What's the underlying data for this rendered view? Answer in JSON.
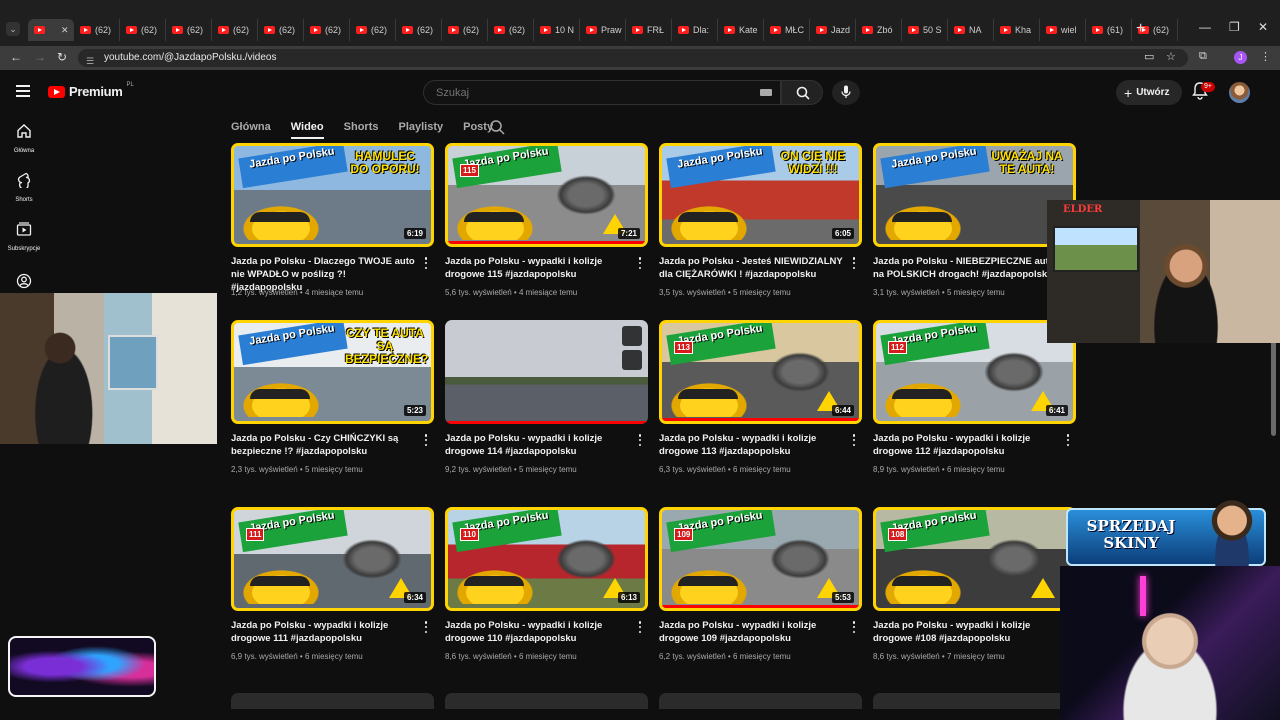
{
  "browser": {
    "tabs": [
      {
        "label": "",
        "active": true
      },
      {
        "label": "(62)"
      },
      {
        "label": "(62)"
      },
      {
        "label": "(62)"
      },
      {
        "label": "(62)"
      },
      {
        "label": "(62)"
      },
      {
        "label": "(62)"
      },
      {
        "label": "(62)"
      },
      {
        "label": "(62)"
      },
      {
        "label": "(62)"
      },
      {
        "label": "(62)"
      },
      {
        "label": "10 N"
      },
      {
        "label": "Praw"
      },
      {
        "label": "FRŁ"
      },
      {
        "label": "Dla:"
      },
      {
        "label": "Kate"
      },
      {
        "label": "MŁC"
      },
      {
        "label": "Jazd"
      },
      {
        "label": "Zbó"
      },
      {
        "label": "50 S"
      },
      {
        "label": "NA"
      },
      {
        "label": "Kha"
      },
      {
        "label": "wiel"
      },
      {
        "label": "(61)"
      },
      {
        "label": "(62)"
      }
    ],
    "url": "youtube.com/@JazdapoPolsku./videos",
    "profile_initial": "J"
  },
  "header": {
    "logo_text": "Premium",
    "logo_country": "PL",
    "search_placeholder": "Szukaj",
    "create_label": "Utwórz",
    "notification_badge": "9+"
  },
  "guide": {
    "items": [
      {
        "label": "Główna",
        "icon": "home-icon"
      },
      {
        "label": "Shorts",
        "icon": "shorts-icon"
      },
      {
        "label": "Subskrypcje",
        "icon": "subscriptions-icon"
      },
      {
        "label": "",
        "icon": "you-icon"
      }
    ]
  },
  "channel_tabs": [
    {
      "label": "Główna"
    },
    {
      "label": "Wideo",
      "active": true
    },
    {
      "label": "Shorts"
    },
    {
      "label": "Playlisty"
    },
    {
      "label": "Posty"
    }
  ],
  "videos": [
    {
      "title": "Jazda po Polsku - Dlaczego TWOJE auto nie WPADŁO w poślizg ?! #jazdapopolsku",
      "views": "1,2 tys. wyświetleń",
      "age": "4 miesiące temu",
      "duration": "6:19",
      "banner": "Jazda po Polsku",
      "headline": "HAMULEC DO OPORU!",
      "style": "blue",
      "progress": 0
    },
    {
      "title": "Jazda po Polsku - wypadki i kolizje drogowe 115 #jazdapopolsku",
      "views": "5,6 tys. wyświetleń",
      "age": "4 miesiące temu",
      "duration": "7:21",
      "banner": "Jazda po Polsku",
      "badge": "115",
      "style": "green",
      "progress": 1.0
    },
    {
      "title": "Jazda po Polsku - Jesteś NIEWIDZIALNY dla CIĘŻARÓWKI ! #jazdapopolsku",
      "views": "3,5 tys. wyświetleń",
      "age": "5 miesięcy temu",
      "duration": "6:05",
      "banner": "Jazda po Polsku",
      "headline": "ON CIĘ NIE WIDZI !!!",
      "style": "blue",
      "progress": 0
    },
    {
      "title": "Jazda po Polsku - NIEBEZPIECZNE auta na POLSKICH drogach! #jazdapopolsku",
      "views": "3,1 tys. wyświetleń",
      "age": "5 miesięcy temu",
      "duration": "",
      "banner": "Jazda po Polsku",
      "headline": "UWAŻAJ NA TE AUTA!",
      "style": "blue",
      "progress": 0
    },
    {
      "title": "Jazda po Polsku - Czy CHIŃCZYKI są bezpieczne !? #jazdapopolsku",
      "views": "2,3 tys. wyświetleń",
      "age": "5 miesięcy temu",
      "duration": "5:23",
      "banner": "Jazda po Polsku",
      "headline": "CZY TE AUTA SĄ BEZPIECZNE?",
      "style": "blue",
      "progress": 0
    },
    {
      "title": "Jazda po Polsku - wypadki i kolizje drogowe 114 #jazdapopolsku",
      "views": "9,2 tys. wyświetleń",
      "age": "5 miesięcy temu",
      "duration": "",
      "banner": "",
      "style": "preview",
      "progress": 1.0
    },
    {
      "title": "Jazda po Polsku - wypadki i kolizje drogowe 113 #jazdapopolsku",
      "views": "6,3 tys. wyświetleń",
      "age": "6 miesięcy temu",
      "duration": "6:44",
      "banner": "Jazda po Polsku",
      "badge": "113",
      "style": "green",
      "progress": 1.0
    },
    {
      "title": "Jazda po Polsku - wypadki i kolizje drogowe 112 #jazdapopolsku",
      "views": "8,9 tys. wyświetleń",
      "age": "6 miesięcy temu",
      "duration": "6:41",
      "banner": "Jazda po Polsku",
      "badge": "112",
      "style": "green",
      "progress": 0
    },
    {
      "title": "Jazda po Polsku - wypadki i kolizje drogowe 111 #jazdapopolsku",
      "views": "6,9 tys. wyświetleń",
      "age": "6 miesięcy temu",
      "duration": "6:34",
      "banner": "Jazda po Polsku",
      "badge": "111",
      "style": "green",
      "progress": 0
    },
    {
      "title": "Jazda po Polsku - wypadki i kolizje drogowe 110 #jazdapopolsku",
      "views": "8,6 tys. wyświetleń",
      "age": "6 miesięcy temu",
      "duration": "6:13",
      "banner": "Jazda po Polsku",
      "badge": "110",
      "style": "green",
      "progress": 0
    },
    {
      "title": "Jazda po Polsku - wypadki i kolizje drogowe 109 #jazdapopolsku",
      "views": "6,2 tys. wyświetleń",
      "age": "6 miesięcy temu",
      "duration": "5:53",
      "banner": "Jazda po Polsku",
      "badge": "109",
      "style": "green",
      "progress": 1.0
    },
    {
      "title": "Jazda po Polsku - wypadki i kolizje drogowe #108 #jazdapopolsku",
      "views": "8,6 tys. wyświetleń",
      "age": "7 miesięcy temu",
      "duration": "",
      "banner": "Jazda po Polsku",
      "badge": "108",
      "style": "green",
      "progress": 0
    }
  ],
  "overlays": {
    "streamer_tag": "ELDER",
    "promo_text": "SPRZEDAJ SKINY"
  },
  "colors": {
    "background": "#0f0f0f",
    "accent_red": "#ff0000",
    "thumb_border": "#ffd400",
    "banner_green": "#1ca23a",
    "banner_blue": "#2a7fd4"
  }
}
